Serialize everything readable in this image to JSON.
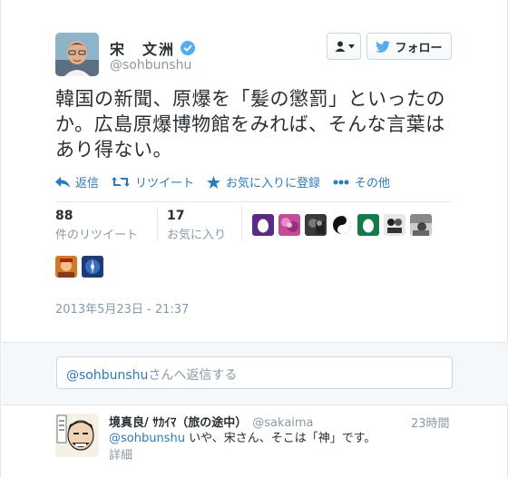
{
  "tweet": {
    "author": {
      "name": "宋　文洲",
      "handle": "@sohbunshu",
      "avatar_icon": "user-avatar-icon",
      "verified_icon": "verified-badge-icon"
    },
    "header_buttons": {
      "user_dropdown_icon": "user-dropdown-icon",
      "follow_label": "フォロー",
      "follow_icon": "twitter-bird-icon"
    },
    "text": "韓国の新聞、原爆を「髪の懲罰」といったのか。広島原爆博物館をみれば、そんな言葉はあり得ない。",
    "actions": {
      "reply": "返信",
      "retweet": "リツイート",
      "favorite": "お気に入りに登録",
      "more": "その他"
    },
    "stats": {
      "retweets_count": "88",
      "retweets_label": "件のリツイート",
      "favorites_count": "17",
      "favorites_label": "お気に入り"
    },
    "timestamp": "2013年5月23日 - 21:37"
  },
  "reply_box": {
    "mention": "@sohbunshu",
    "placeholder_rest": "さんへ返信する"
  },
  "reply_tweet": {
    "name": "境真良/ ｻｶｲﾏ（旅の途中）",
    "handle": "@sakaima",
    "time": "23時間",
    "mention": "@sohbunshu",
    "text": " いや、宋さん、そこは「神」です。",
    "detail": "詳細"
  },
  "colors": {
    "link": "#2b7bb9",
    "muted": "#8899a6",
    "text": "#292f33",
    "verified": "#55acee"
  }
}
